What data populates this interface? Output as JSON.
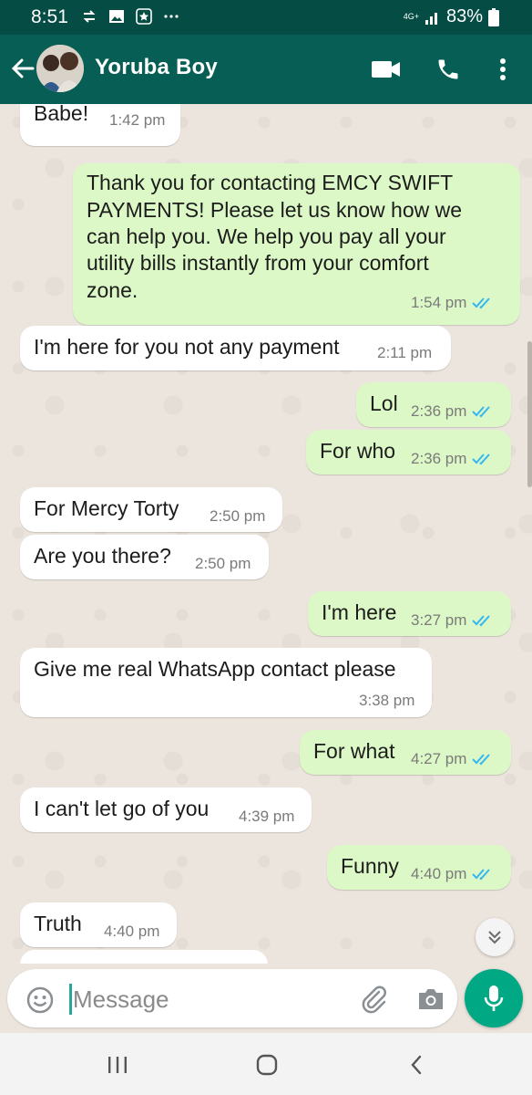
{
  "status_bar": {
    "time": "8:51",
    "network": "4G+",
    "battery": "83%",
    "icons": [
      "sync-icon",
      "gallery-icon",
      "star-app-icon",
      "more-notifications-icon",
      "signal-icon",
      "battery-icon"
    ]
  },
  "header": {
    "contact_name": "Yoruba Boy",
    "icons": [
      "back-arrow-icon",
      "video-call-icon",
      "phone-icon",
      "more-vert-icon"
    ]
  },
  "messages": [
    {
      "direction": "in",
      "text": "Babe!",
      "time": "1:42 pm"
    },
    {
      "direction": "out",
      "text": "Thank you for contacting EMCY SWIFT PAYMENTS! Please let us know how we can help you. We help you pay all your utility bills instantly from your comfort zone.",
      "lines": [
        "Thank you for contacting EMCY SWIFT",
        "PAYMENTS! Please let us know how we",
        "can help you. We help you pay all your",
        "utility bills instantly from your comfort",
        "zone."
      ],
      "time": "1:54 pm",
      "read": true
    },
    {
      "direction": "in",
      "text": "I'm here for you not any payment",
      "time": "2:11 pm"
    },
    {
      "direction": "out",
      "text": "Lol",
      "time": "2:36 pm",
      "read": true
    },
    {
      "direction": "out",
      "text": "For who",
      "time": "2:36 pm",
      "read": true
    },
    {
      "direction": "in",
      "text": "For Mercy Torty",
      "time": "2:50 pm"
    },
    {
      "direction": "in",
      "text": "Are you there?",
      "time": "2:50 pm"
    },
    {
      "direction": "out",
      "text": "I'm here",
      "time": "3:27 pm",
      "read": true
    },
    {
      "direction": "in",
      "text": "Give me real WhatsApp contact please",
      "time": "3:38 pm"
    },
    {
      "direction": "out",
      "text": "For what",
      "time": "4:27 pm",
      "read": true
    },
    {
      "direction": "in",
      "text": "I can't let go of you",
      "time": "4:39 pm"
    },
    {
      "direction": "out",
      "text": "Funny",
      "time": "4:40 pm",
      "read": true
    },
    {
      "direction": "in",
      "text": "Truth",
      "time": "4:40 pm"
    }
  ],
  "input": {
    "placeholder": "Message"
  },
  "colors": {
    "header": "#075e54",
    "status_bar": "#054d44",
    "outgoing_bubble": "#dcf8c6",
    "incoming_bubble": "#ffffff",
    "chat_background": "#ece5dd",
    "read_ticks": "#34b7f1",
    "mic_button": "#00a884"
  },
  "nav_bar": {
    "icons": [
      "recent-apps-icon",
      "home-icon",
      "back-nav-icon"
    ]
  }
}
